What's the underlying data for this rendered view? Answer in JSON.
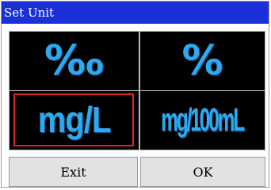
{
  "window": {
    "title": "Set Unit"
  },
  "units": [
    {
      "label": "‰"
    },
    {
      "label": "%"
    },
    {
      "label": "mg/L"
    },
    {
      "label": "mg/100mL"
    }
  ],
  "selected_unit": "mg/L",
  "buttons": {
    "exit_label": "Exit",
    "ok_label": "OK"
  },
  "colors": {
    "titlebar": "#1c30d8",
    "unit_text": "#2ea8ee",
    "selection_border": "#e2202a",
    "cell_background": "#000000",
    "button_background": "#e2e2e2"
  }
}
